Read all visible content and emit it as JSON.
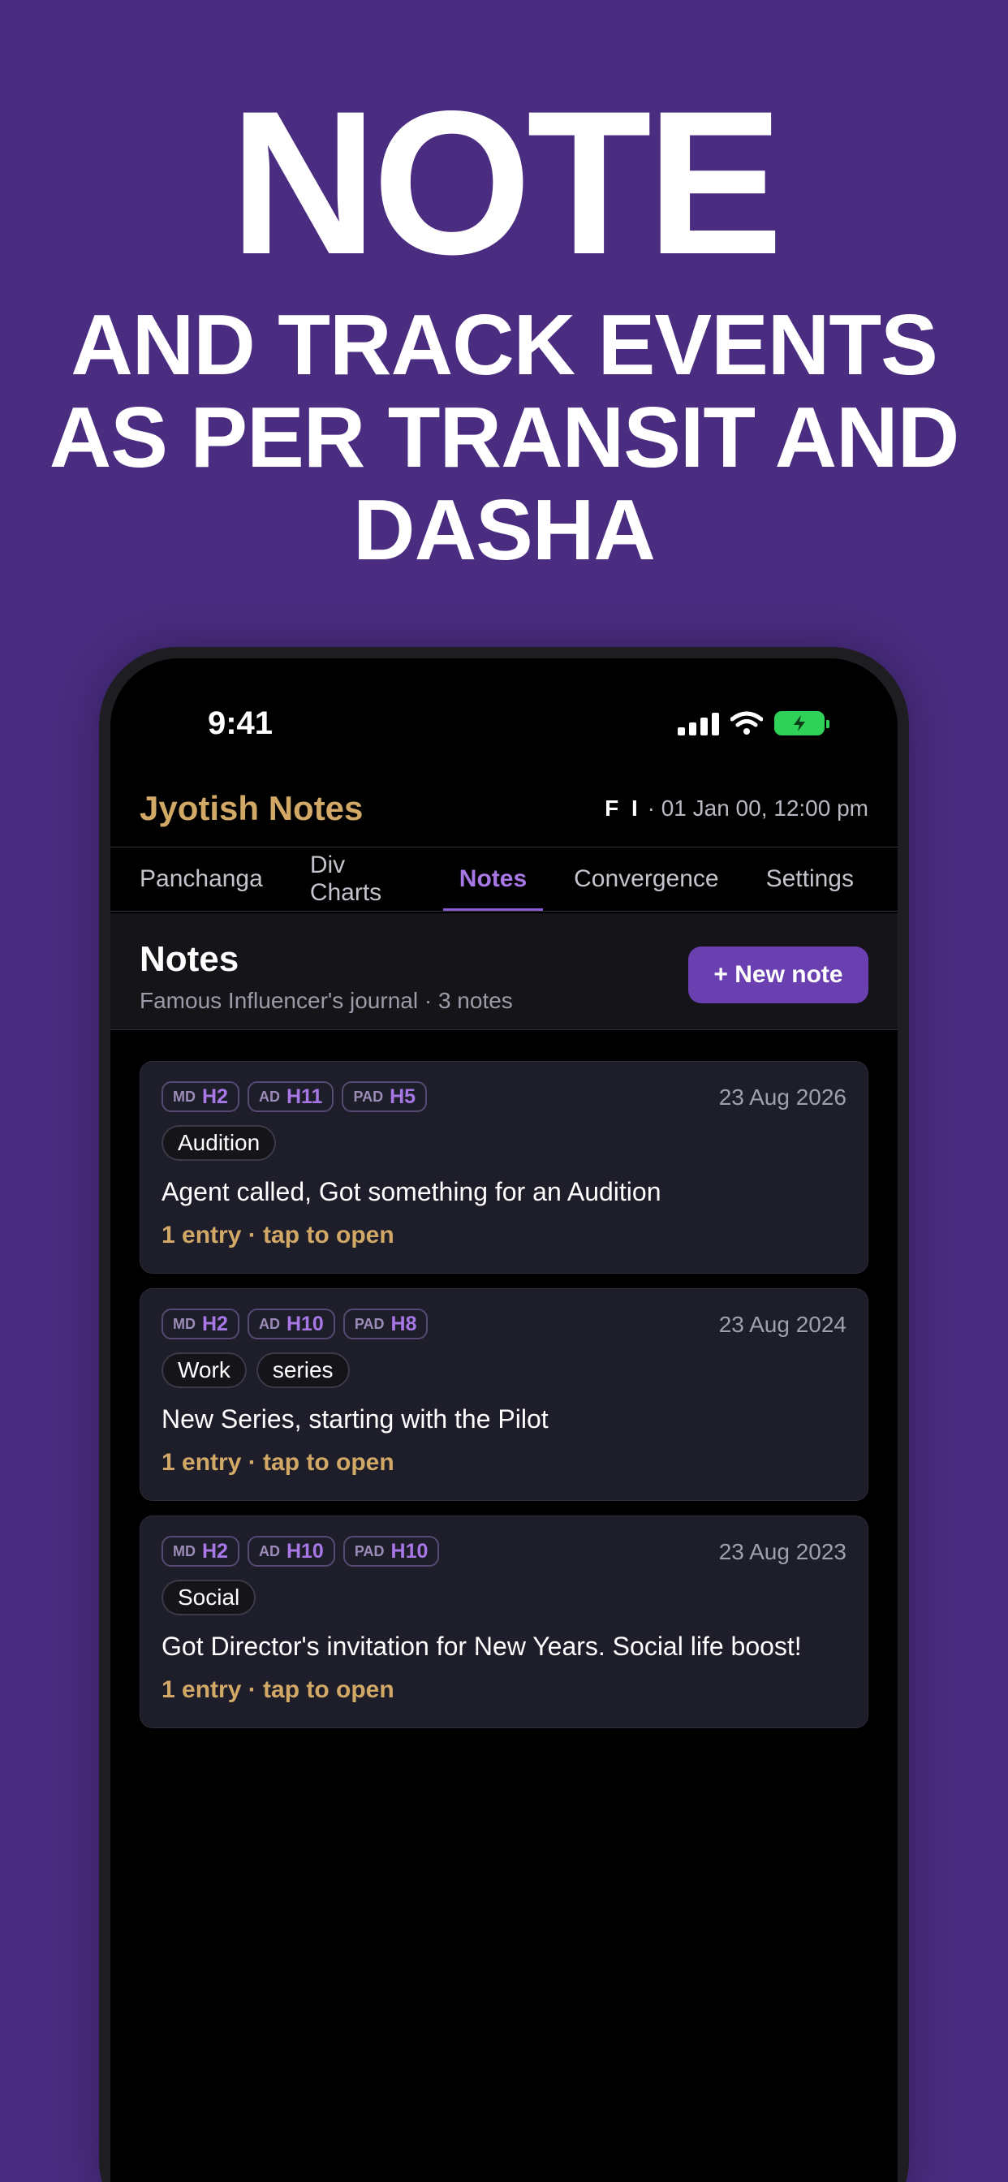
{
  "promo": {
    "headline": "NOTE",
    "subline_lines": [
      "AND TRACK EVENTS",
      "AS PER TRANSIT AND",
      "DASHA"
    ]
  },
  "status_bar": {
    "time": "9:41"
  },
  "app": {
    "title": "Jyotish Notes",
    "initials": "F I",
    "datetime": "· 01 Jan 00, 12:00 pm"
  },
  "tabs": [
    "Panchanga",
    "Div Charts",
    "Notes",
    "Convergence",
    "Settings"
  ],
  "active_tab": "Notes",
  "notes_header": {
    "title": "Notes",
    "subtitle": "Famous Influencer's journal · 3 notes",
    "new_note_label": "+ New note"
  },
  "notes": [
    {
      "badges": [
        {
          "k": "MD",
          "v": "H2"
        },
        {
          "k": "AD",
          "v": "H11"
        },
        {
          "k": "PAD",
          "v": "H5"
        }
      ],
      "date": "23 Aug 2026",
      "tags": [
        "Audition"
      ],
      "text": "Agent called, Got something for an Audition",
      "entry": "1 entry · tap to open"
    },
    {
      "badges": [
        {
          "k": "MD",
          "v": "H2"
        },
        {
          "k": "AD",
          "v": "H10"
        },
        {
          "k": "PAD",
          "v": "H8"
        }
      ],
      "date": "23 Aug 2024",
      "tags": [
        "Work",
        "series"
      ],
      "text": "New Series, starting with the Pilot",
      "entry": "1 entry · tap to open"
    },
    {
      "badges": [
        {
          "k": "MD",
          "v": "H2"
        },
        {
          "k": "AD",
          "v": "H10"
        },
        {
          "k": "PAD",
          "v": "H10"
        }
      ],
      "date": "23 Aug 2023",
      "tags": [
        "Social"
      ],
      "text": "Got Director's invitation for New Years. Social life boost!",
      "entry": "1 entry · tap to open"
    }
  ],
  "colors": {
    "background": "#4a2c80",
    "accent": "#a777e6",
    "gold": "#d1a866",
    "button": "#6a3fb0",
    "battery": "#30d158"
  }
}
